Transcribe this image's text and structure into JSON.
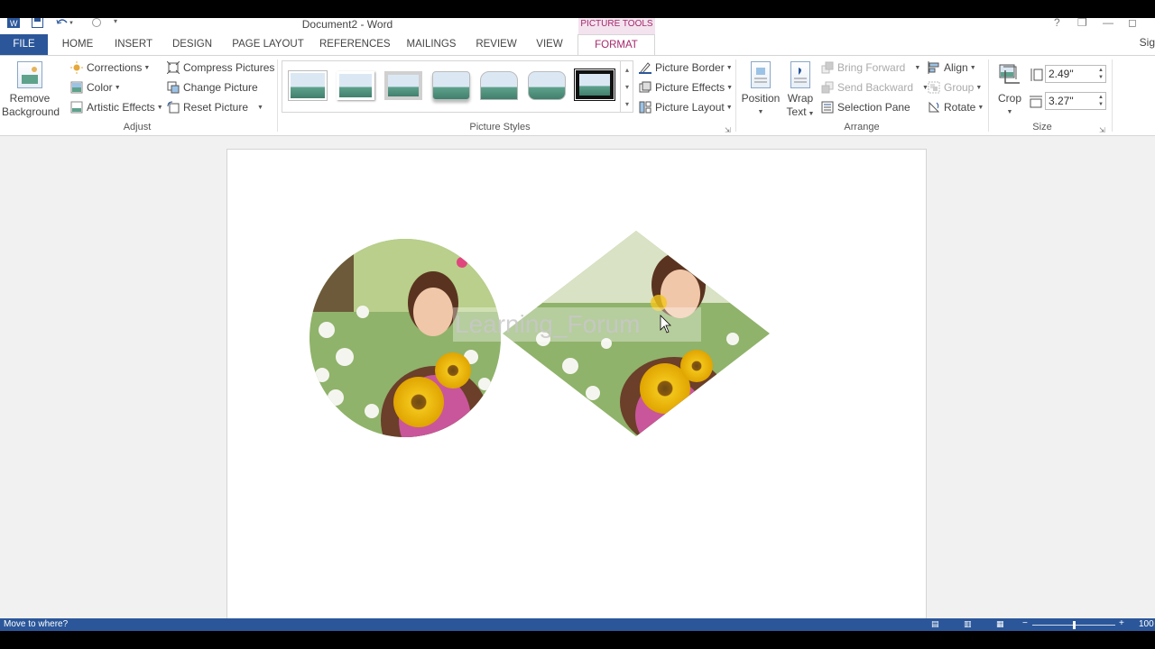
{
  "window": {
    "title": "Document2 - Word",
    "contextual_tab_group": "PICTURE TOOLS",
    "controls": [
      "?",
      "❐",
      "—",
      "◻"
    ]
  },
  "tabs": [
    {
      "label": "FILE"
    },
    {
      "label": "HOME"
    },
    {
      "label": "INSERT"
    },
    {
      "label": "DESIGN"
    },
    {
      "label": "PAGE LAYOUT"
    },
    {
      "label": "REFERENCES"
    },
    {
      "label": "MAILINGS"
    },
    {
      "label": "REVIEW"
    },
    {
      "label": "VIEW"
    },
    {
      "label": "FORMAT"
    }
  ],
  "signin": "Sig",
  "ribbon": {
    "adjust": {
      "remove_background_line1": "Remove",
      "remove_background_line2": "Background",
      "corrections": "Corrections",
      "color": "Color",
      "artistic_effects": "Artistic Effects",
      "compress_pictures": "Compress Pictures",
      "change_picture": "Change Picture",
      "reset_picture": "Reset Picture",
      "group_label": "Adjust"
    },
    "picture_styles": {
      "picture_border": "Picture Border",
      "picture_effects": "Picture Effects",
      "picture_layout": "Picture Layout",
      "group_label": "Picture Styles"
    },
    "arrange": {
      "position": "Position",
      "wrap_text_line1": "Wrap",
      "wrap_text_line2": "Text",
      "bring_forward": "Bring Forward",
      "send_backward": "Send Backward",
      "selection_pane": "Selection Pane",
      "align": "Align",
      "group": "Group",
      "rotate": "Rotate",
      "group_label": "Arrange"
    },
    "size": {
      "crop": "Crop",
      "height": "2.49\"",
      "width": "3.27\"",
      "group_label": "Size"
    }
  },
  "document": {
    "watermark": "Learning_Forum"
  },
  "status": {
    "text": "Move to where?",
    "zoom": "100"
  },
  "colors": {
    "accent": "#2b579a",
    "format_tab": "#a4286b",
    "picture_tools_bg": "#f3e3ee"
  }
}
